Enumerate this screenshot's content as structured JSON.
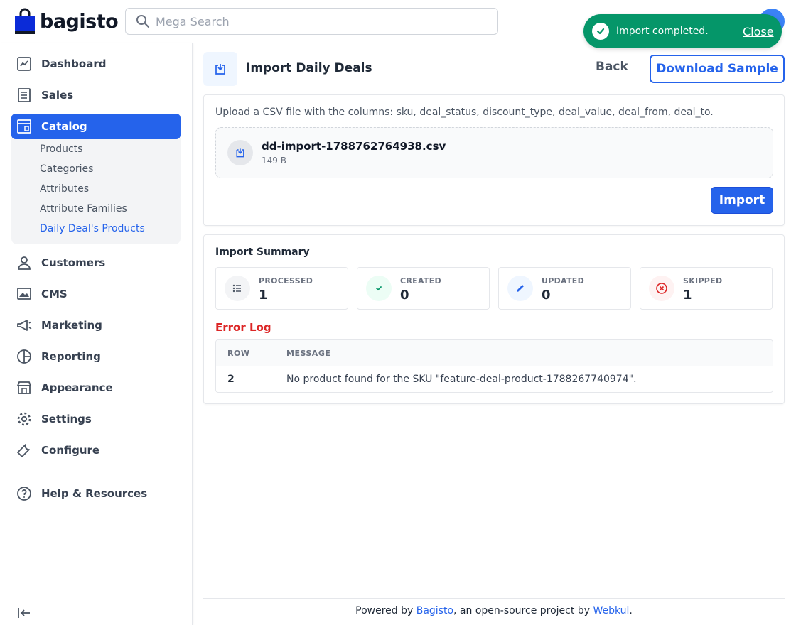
{
  "header": {
    "logo_text": "bagisto",
    "search_placeholder": "Mega Search"
  },
  "toast": {
    "message": "Import completed.",
    "close_label": "Close",
    "color": "#059669"
  },
  "sidebar": {
    "items": [
      {
        "label": "Dashboard",
        "icon": "dashboard-icon"
      },
      {
        "label": "Sales",
        "icon": "sales-icon"
      },
      {
        "label": "Catalog",
        "icon": "catalog-icon",
        "active": true
      },
      {
        "label": "Customers",
        "icon": "customers-icon"
      },
      {
        "label": "CMS",
        "icon": "cms-icon"
      },
      {
        "label": "Marketing",
        "icon": "marketing-icon"
      },
      {
        "label": "Reporting",
        "icon": "reporting-icon"
      },
      {
        "label": "Appearance",
        "icon": "appearance-icon"
      },
      {
        "label": "Settings",
        "icon": "gear-icon"
      },
      {
        "label": "Configure",
        "icon": "wrench-icon"
      },
      {
        "label": "Help & Resources",
        "icon": "help-icon"
      }
    ],
    "catalog_sub": [
      {
        "label": "Products"
      },
      {
        "label": "Categories"
      },
      {
        "label": "Attributes"
      },
      {
        "label": "Attribute Families"
      },
      {
        "label": "Daily Deal's Products",
        "current": true
      }
    ],
    "accent_color": "#2563eb"
  },
  "page": {
    "title": "Import Daily Deals",
    "back_label": "Back",
    "download_label": "Download Sample"
  },
  "upload": {
    "hint": "Upload a CSV file with the columns: sku, deal_status, discount_type, deal_value, deal_from, deal_to.",
    "file_name": "dd-import-1788762764938.csv",
    "file_size": "149 B",
    "import_label": "Import"
  },
  "summary": {
    "title": "Import Summary",
    "stats": [
      {
        "label": "PROCESSED",
        "value": "1",
        "icon": "list-icon"
      },
      {
        "label": "CREATED",
        "value": "0",
        "icon": "check-icon"
      },
      {
        "label": "UPDATED",
        "value": "0",
        "icon": "pencil-icon"
      },
      {
        "label": "SKIPPED",
        "value": "1",
        "icon": "x-circle-icon"
      }
    ],
    "error_title": "Error Log",
    "error_columns": [
      "ROW",
      "MESSAGE"
    ],
    "errors": [
      {
        "row": "2",
        "message": "No product found for the SKU \"feature-deal-product-1788267740974\"."
      }
    ]
  },
  "footer": {
    "prefix": "Powered by ",
    "link1": "Bagisto",
    "middle": ", an open-source project by ",
    "link2": "Webkul",
    "suffix": "."
  }
}
